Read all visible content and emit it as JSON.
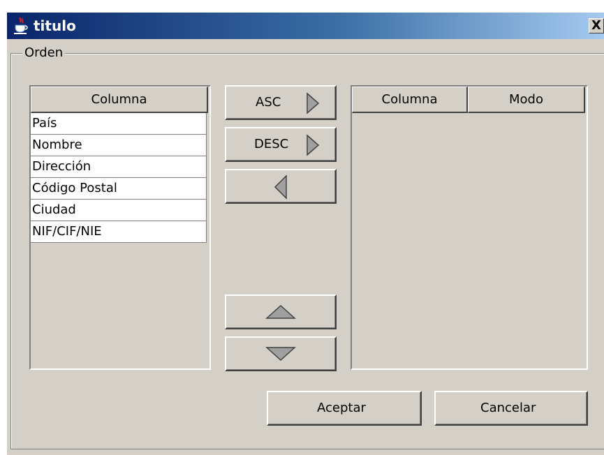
{
  "window": {
    "title": "titulo",
    "close_glyph": "X"
  },
  "group": {
    "legend": "Orden"
  },
  "left_table": {
    "header": "Columna",
    "rows": [
      "País",
      "Nombre",
      "Dirección",
      "Código Postal",
      "Ciudad",
      "NIF/CIF/NIE"
    ]
  },
  "buttons": {
    "asc": "ASC",
    "desc": "DESC",
    "accept": "Aceptar",
    "cancel": "Cancelar"
  },
  "right_table": {
    "headers": [
      "Columna",
      "Modo"
    ]
  },
  "icons": {
    "title": "java-coffee-icon",
    "asc": "arrow-right-icon",
    "desc": "arrow-right-icon",
    "remove": "arrow-left-icon",
    "up": "arrow-up-icon",
    "down": "arrow-down-icon",
    "close": "close-icon"
  },
  "colors": {
    "window_bg": "#d4d0c8",
    "title_start": "#0a246a",
    "title_end": "#a6caf0",
    "arrow_fill": "#a0a0a0"
  }
}
